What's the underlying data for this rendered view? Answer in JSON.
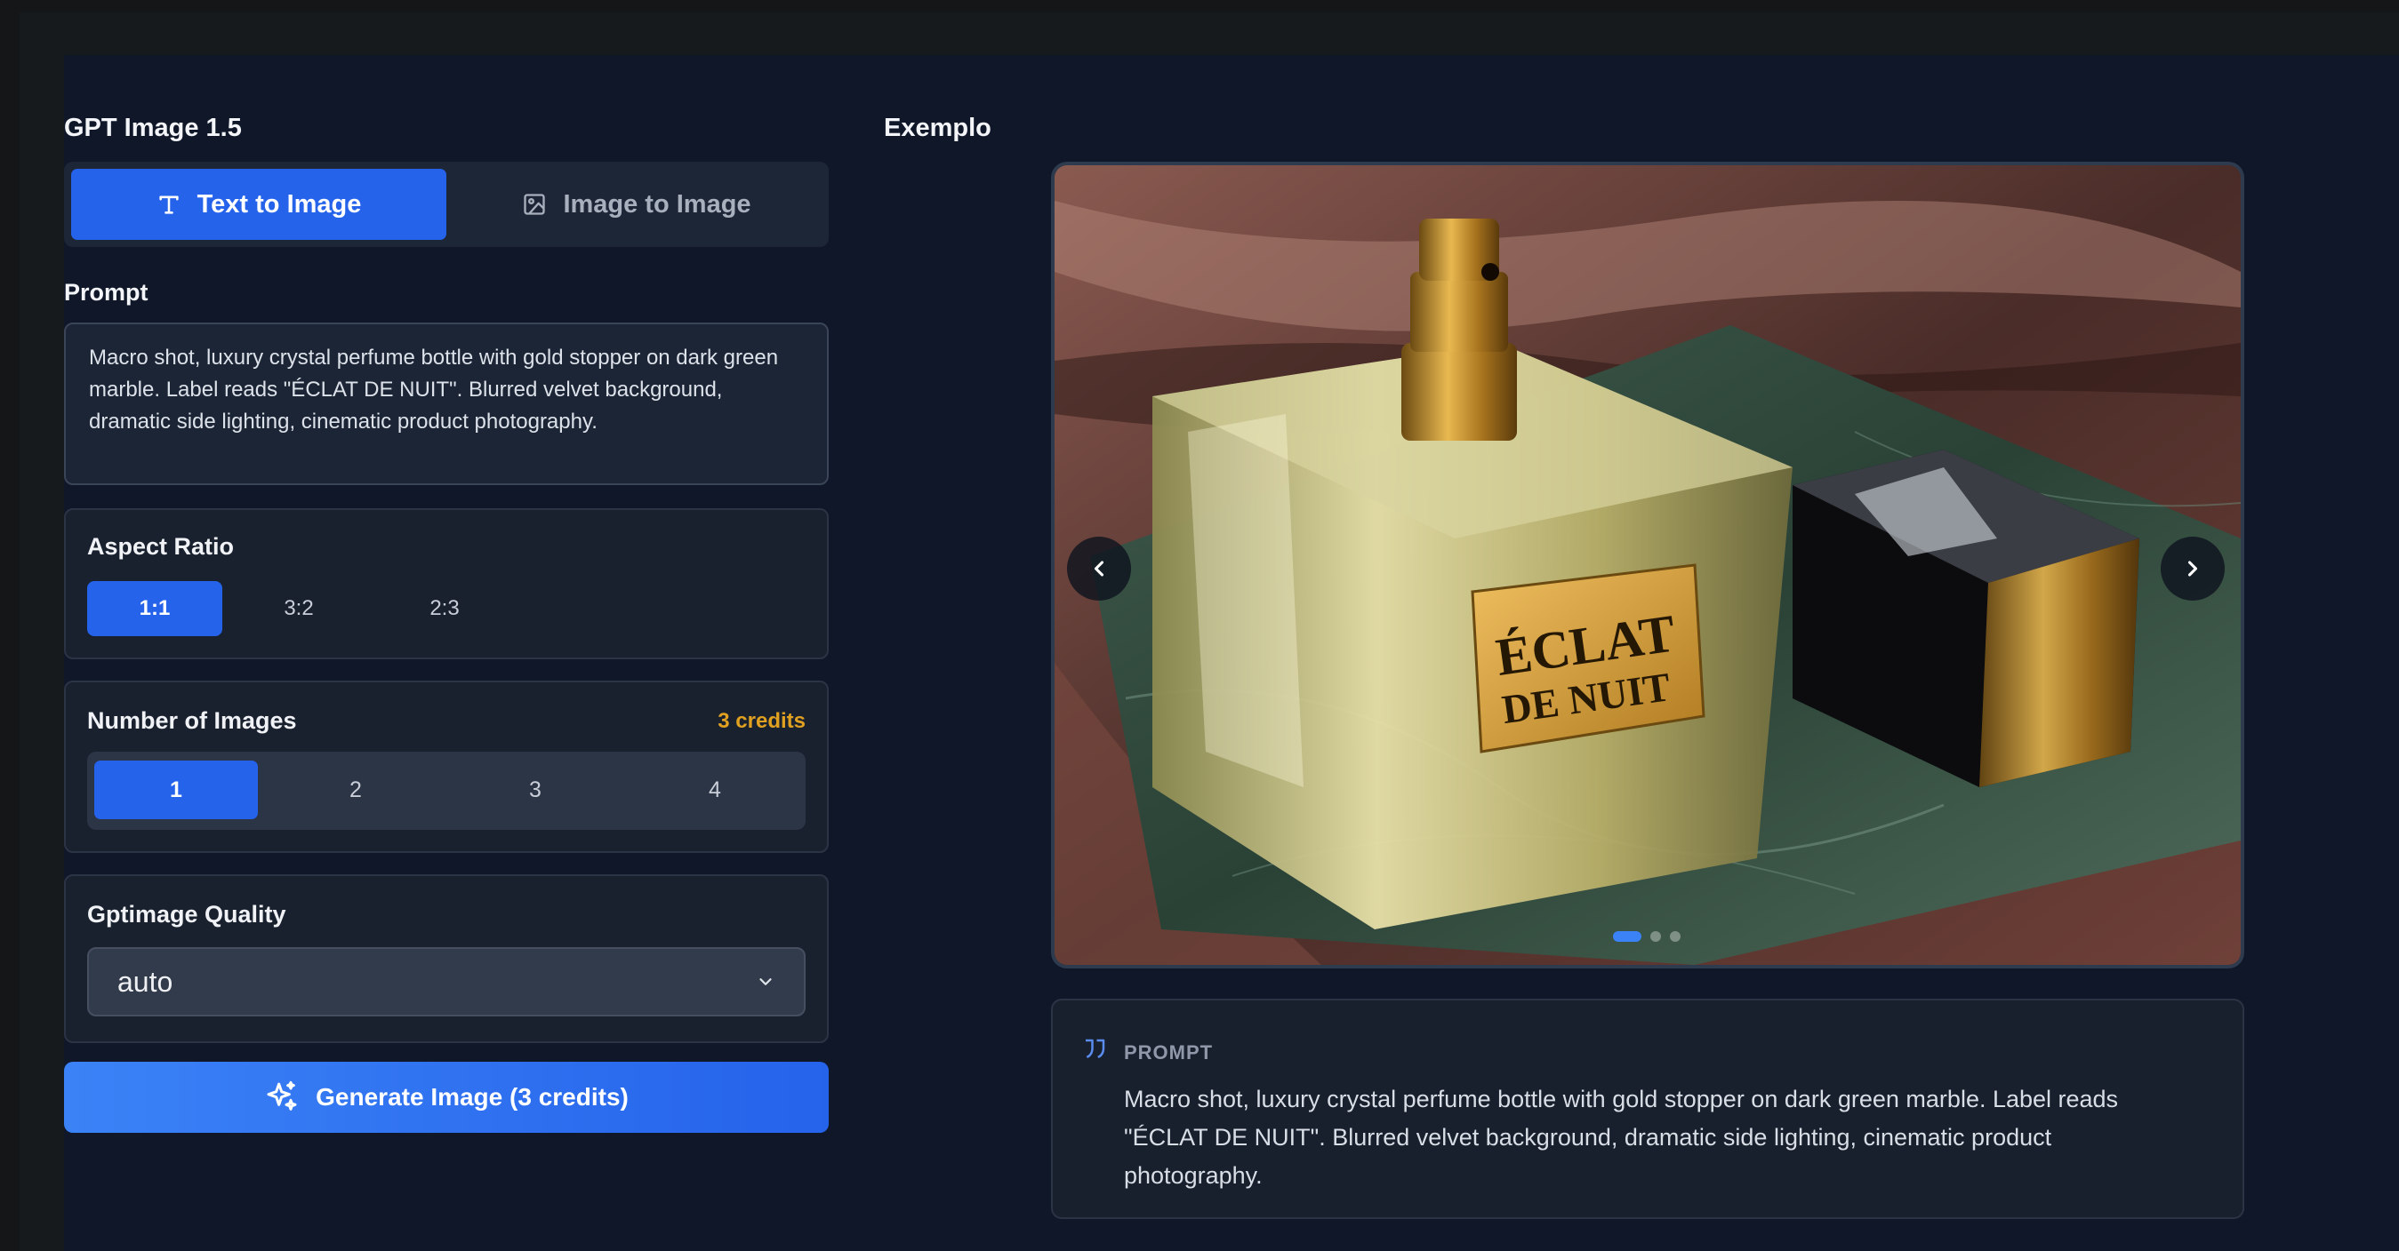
{
  "panel": {
    "title": "GPT Image 1.5",
    "tabs": [
      {
        "label": "Text to Image",
        "icon": "text-icon",
        "active": true
      },
      {
        "label": "Image to Image",
        "icon": "image-icon",
        "active": false
      }
    ],
    "prompt_label": "Prompt",
    "prompt_value": "Macro shot, luxury crystal perfume bottle with gold stopper on dark green marble. Label reads \"ÉCLAT DE NUIT\". Blurred velvet background, dramatic side lighting, cinematic product photography.",
    "aspect_ratio": {
      "label": "Aspect Ratio",
      "options": [
        "1:1",
        "3:2",
        "2:3"
      ],
      "selected": "1:1"
    },
    "num_images": {
      "label": "Number of Images",
      "credits": "3 credits",
      "options": [
        "1",
        "2",
        "3",
        "4"
      ],
      "selected": "1"
    },
    "quality": {
      "label": "Gptimage Quality",
      "value": "auto"
    },
    "generate_label": "Generate Image (3 credits)"
  },
  "example": {
    "title": "Exemplo",
    "image_label_line1": "ÉCLAT",
    "image_label_line2": "DE NUIT",
    "slide_count": 3,
    "active_slide": 1,
    "prompt_heading": "PROMPT",
    "prompt_text": "Macro shot, luxury crystal perfume bottle with gold stopper on dark green marble. Label reads \"ÉCLAT DE NUIT\". Blurred velvet background, dramatic side lighting, cinematic product photography."
  },
  "colors": {
    "accent": "#2563eb",
    "credits": "#e0a020",
    "background": "#0f1728"
  }
}
